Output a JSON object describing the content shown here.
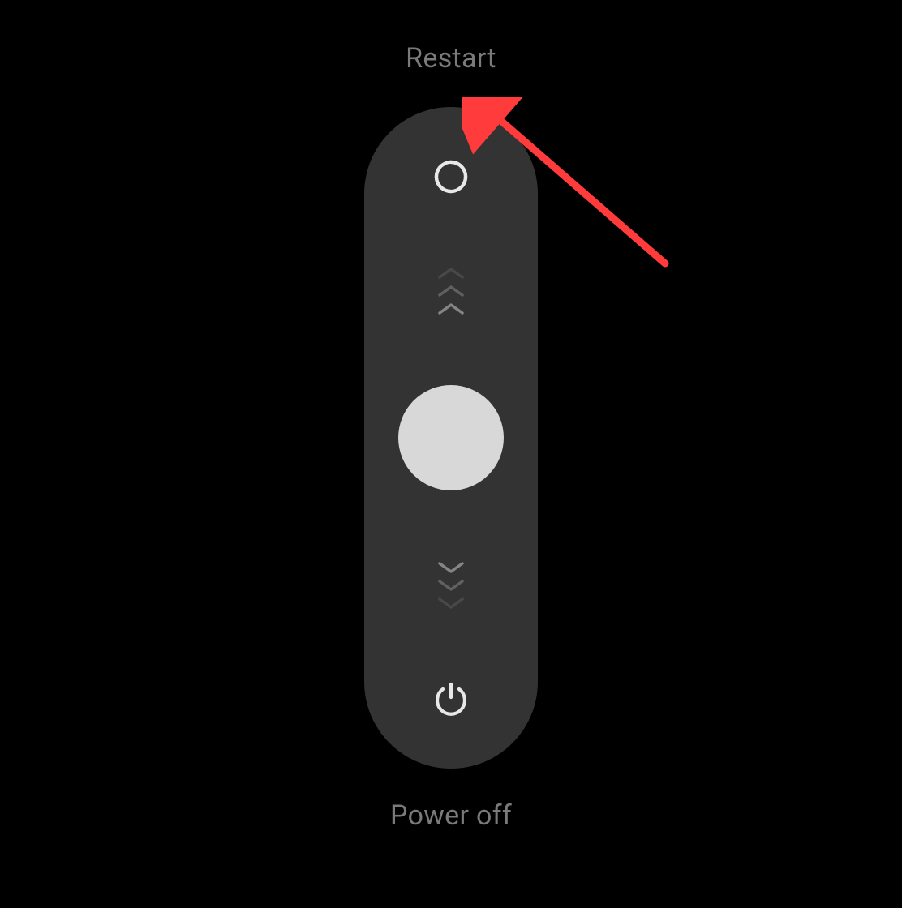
{
  "labels": {
    "restart": "Restart",
    "power_off": "Power off"
  },
  "icons": {
    "restart": "restart-icon",
    "power": "power-icon",
    "chevron_up": "chevron-up-icon",
    "chevron_down": "chevron-down-icon"
  },
  "colors": {
    "background": "#000000",
    "track": "#333333",
    "handle": "#d8d8d8",
    "label": "#7a7a7a",
    "icon": "#e8e8e8",
    "arrow": "#ff3b3b"
  }
}
